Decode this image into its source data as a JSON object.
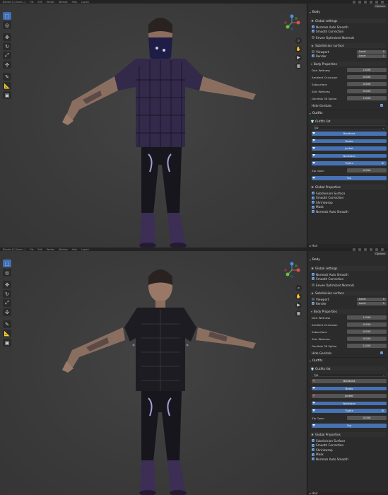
{
  "top": {
    "menubar": {
      "items": [
        "Blender [C:\\Users...]",
        "File",
        "Edit",
        "Render",
        "Window",
        "Help",
        "Layout"
      ]
    },
    "panel": {
      "options_label": "Options",
      "section_title": "Body",
      "global_settings": "Global settings",
      "normals_auto_smooth": "Normals Auto Smooth",
      "smooth_correction": "Smooth Correction",
      "eevee_optimized_normals": "Eevee Optimized Normals",
      "subdivision_surface": "Subdivision surface",
      "viewport": "Viewport",
      "render": "Render",
      "level_label": "Level",
      "viewport_level": "0",
      "render_level": "1",
      "body_properties": "Body Properties",
      "fields": [
        {
          "label": "Dick Wetness",
          "value": "1.000"
        },
        {
          "label": "Ambient Occlusion",
          "value": "0.000"
        },
        {
          "label": "Subsurface",
          "value": "0.000"
        },
        {
          "label": "Skin Wetness",
          "value": "0.000"
        },
        {
          "label": "Genitals 3K Spline",
          "value": "1.000"
        }
      ],
      "hide_genitals": "Hide Genitals",
      "outfits": "Outfits",
      "outfits_list": "Outfits list",
      "outfit_preset": "TJD",
      "outfit_items": [
        "Bandana",
        "Boots",
        "Jacket",
        "Necklace",
        "Tights"
      ],
      "zip_open_label": "Zip Open",
      "zip_open_value": "0.000",
      "top_item": "Top",
      "global_properties": "Global Properties",
      "global_props": [
        "Subdivision Surface",
        "Smooth Correction",
        "Shrinkwrap",
        "Mask",
        "Normals Auto Smooth"
      ],
      "bottom_label": "Hair"
    }
  },
  "bottom": {
    "menubar": {
      "items": [
        "Blender [C:\\Users...]",
        "File",
        "Edit",
        "Render",
        "Window",
        "Help",
        "Layout"
      ]
    },
    "panel": {
      "options_label": "Options",
      "section_title": "Body",
      "global_settings": "Global settings",
      "normals_auto_smooth": "Normals Auto Smooth",
      "smooth_correction": "Smooth Correction",
      "eevee_optimized_normals": "Eevee Optimized Normals",
      "subdivision_surface": "Subdivision surface",
      "viewport": "Viewport",
      "render": "Render",
      "level_label": "Level",
      "viewport_level": "0",
      "render_level": "1",
      "body_properties": "Body Properties",
      "fields": [
        {
          "label": "Dick Wetness",
          "value": "1.000"
        },
        {
          "label": "Ambient Occlusion",
          "value": "0.000"
        },
        {
          "label": "Subsurface",
          "value": "0.000"
        },
        {
          "label": "Skin Wetness",
          "value": "0.000"
        },
        {
          "label": "Genitals 3K Spline",
          "value": "1.000"
        }
      ],
      "hide_genitals": "Hide Genitals",
      "outfits": "Outfits",
      "outfits_list": "Outfits list",
      "outfit_preset": "TJD",
      "outfit_items": [
        "Bandana",
        "Boots",
        "Jacket",
        "Necklace",
        "Tights"
      ],
      "zip_open_label": "Zip Open",
      "zip_open_value": "0.000",
      "top_item": "Top",
      "global_properties": "Global Properties",
      "global_props": [
        "Subdivision Surface",
        "Smooth Correction",
        "Shrinkwrap",
        "Mask",
        "Normals Auto Smooth"
      ],
      "bottom_label": "Hair"
    }
  },
  "colors": {
    "accent": "#4772b3",
    "panel_bg": "#2b2b2b",
    "viewport_bg": "#3d3d3d",
    "field_bg": "#555555",
    "off_red": "#e45a5a"
  },
  "icons": [
    "select-box-icon",
    "cursor-icon",
    "move-icon",
    "rotate-icon",
    "scale-icon",
    "transform-icon",
    "annotate-icon",
    "measure-icon",
    "add-cube-icon",
    "zoom-icon",
    "hand-icon",
    "camera-icon",
    "grid-icon"
  ]
}
